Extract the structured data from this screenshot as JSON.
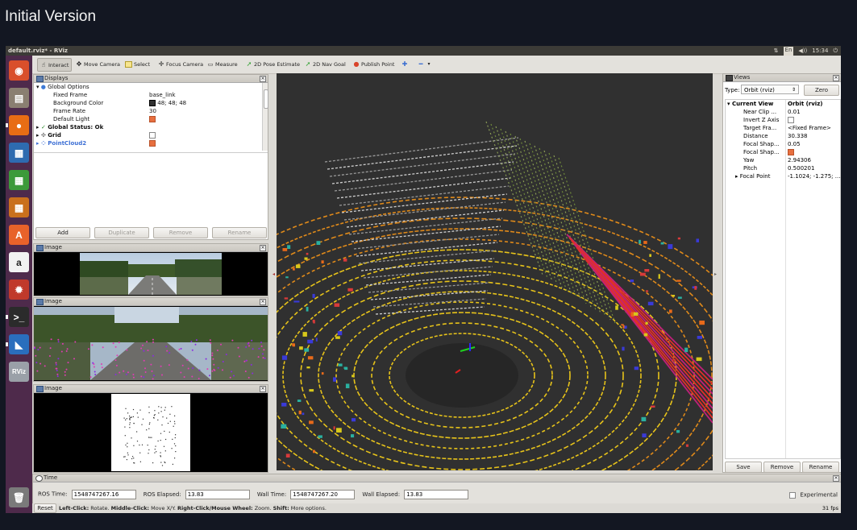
{
  "slide_title": "Initial Version",
  "window": {
    "title": "default.rviz* - RViz",
    "tray": {
      "kb": "En",
      "volume": "◀))",
      "time": "15:34",
      "power": "⏻",
      "net": "⇅"
    }
  },
  "launcher": [
    {
      "name": "ubuntu-dash-icon",
      "glyph": "◉",
      "color": "#d94f2b"
    },
    {
      "name": "files-icon",
      "glyph": "▤",
      "color": "#8a7f71"
    },
    {
      "name": "firefox-icon",
      "glyph": "●",
      "color": "#e86d14"
    },
    {
      "name": "writer-icon",
      "glyph": "▦",
      "color": "#2e6bb0"
    },
    {
      "name": "calc-icon",
      "glyph": "▦",
      "color": "#3c9a3a"
    },
    {
      "name": "impress-icon",
      "glyph": "▦",
      "color": "#c9701d"
    },
    {
      "name": "software-center-icon",
      "glyph": "A",
      "color": "#e8622a"
    },
    {
      "name": "amazon-icon",
      "glyph": "a",
      "color": "#f2f2f2"
    },
    {
      "name": "settings-icon",
      "glyph": "✹",
      "color": "#c0392b"
    },
    {
      "name": "terminal-icon",
      "glyph": ">_",
      "color": "#2b2b2b"
    },
    {
      "name": "vscode-icon",
      "glyph": "◣",
      "color": "#2a6ebd"
    },
    {
      "name": "rviz-icon",
      "glyph": "RViz",
      "color": "#9aa0a8"
    }
  ],
  "launcher_trash": {
    "name": "trash-icon",
    "glyph": "🗑",
    "color": "#7a7a7a"
  },
  "toolbar": {
    "interact": "Interact",
    "move_camera": "Move Camera",
    "select": "Select",
    "focus_camera": "Focus Camera",
    "measure": "Measure",
    "pose_estimate": "2D Pose Estimate",
    "nav_goal": "2D Nav Goal",
    "publish_point": "Publish Point"
  },
  "displays": {
    "title": "Displays",
    "global_options": "Global Options",
    "fixed_frame_label": "Fixed Frame",
    "fixed_frame_value": "base_link",
    "bg_color_label": "Background Color",
    "bg_color_value": "48; 48; 48",
    "frame_rate_label": "Frame Rate",
    "frame_rate_value": "30",
    "default_light_label": "Default Light",
    "global_status": "Global Status: Ok",
    "grid": "Grid",
    "pointcloud": "PointCloud2",
    "add": "Add",
    "duplicate": "Duplicate",
    "remove": "Remove",
    "rename": "Rename"
  },
  "image_panels": [
    "Image",
    "Image",
    "Image"
  ],
  "views": {
    "title": "Views",
    "type_label": "Type:",
    "type_value": "Orbit (rviz)",
    "zero": "Zero",
    "current_view": "Current View",
    "current_view_value": "Orbit (rviz)",
    "props": [
      {
        "k": "Near Clip ...",
        "v": "0.01"
      },
      {
        "k": "Invert Z Axis",
        "v": ""
      },
      {
        "k": "Target Fra...",
        "v": "<Fixed Frame>"
      },
      {
        "k": "Distance",
        "v": "30.338"
      },
      {
        "k": "Focal Shap...",
        "v": "0.05"
      },
      {
        "k": "Focal Shap...",
        "v": ""
      },
      {
        "k": "Yaw",
        "v": "2.94306"
      },
      {
        "k": "Pitch",
        "v": "0.500201"
      },
      {
        "k": "Focal Point",
        "v": "-1.1024; -1.275; ..."
      }
    ],
    "save": "Save",
    "remove": "Remove",
    "rename": "Rename"
  },
  "time": {
    "title": "Time",
    "ros_time_label": "ROS Time:",
    "ros_time": "1548747267.16",
    "ros_elapsed_label": "ROS Elapsed:",
    "ros_elapsed": "13.83",
    "wall_time_label": "Wall Time:",
    "wall_time": "1548747267.20",
    "wall_elapsed_label": "Wall Elapsed:",
    "wall_elapsed": "13.83",
    "experimental": "Experimental"
  },
  "status": {
    "reset": "Reset",
    "left_click": "Left-Click:",
    "left_click_txt": " Rotate. ",
    "middle_click": "Middle-Click:",
    "middle_click_txt": " Move X/Y. ",
    "right_click": "Right-Click/Mouse Wheel:",
    "right_click_txt": " Zoom. ",
    "shift": "Shift:",
    "shift_txt": " More options.",
    "fps": "31 fps"
  }
}
